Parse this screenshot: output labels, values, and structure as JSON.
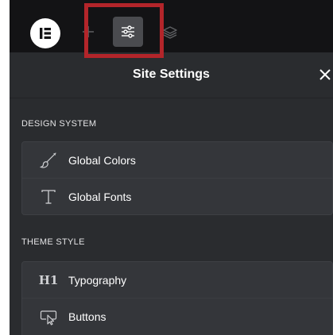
{
  "toolbar": {
    "logo_icon": "elementor-logo-icon",
    "add_icon": "plus-icon",
    "settings_icon": "sliders-icon",
    "layers_icon": "layers-icon"
  },
  "panel": {
    "title": "Site Settings",
    "close_icon": "close-icon"
  },
  "design_system": {
    "heading": "DESIGN SYSTEM",
    "items": [
      {
        "label": "Global Colors",
        "icon": "brush-icon"
      },
      {
        "label": "Global Fonts",
        "icon": "font-icon"
      }
    ]
  },
  "theme_style": {
    "heading": "THEME STYLE",
    "items": [
      {
        "label": "Typography",
        "icon": "heading-icon",
        "glyph": "H1"
      },
      {
        "label": "Buttons",
        "icon": "button-cursor-icon"
      }
    ]
  },
  "colors": {
    "highlight": "#b3252a",
    "panel_bg": "#2a2c2f",
    "topbar_bg": "#131315"
  }
}
